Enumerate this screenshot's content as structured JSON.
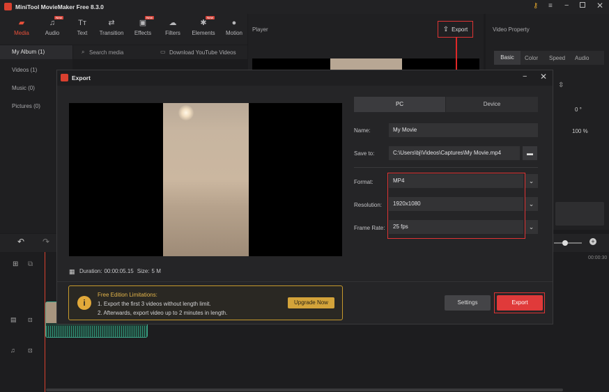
{
  "app": {
    "title": "MiniTool MovieMaker Free 8.3.0"
  },
  "toolbar": {
    "tabs": [
      {
        "label": "Media",
        "icon": "folder-icon"
      },
      {
        "label": "Audio",
        "icon": "music-icon"
      },
      {
        "label": "Text",
        "icon": "text-icon"
      },
      {
        "label": "Transition",
        "icon": "transition-icon"
      },
      {
        "label": "Effects",
        "icon": "effects-icon"
      },
      {
        "label": "Filters",
        "icon": "filters-icon"
      },
      {
        "label": "Elements",
        "icon": "elements-icon"
      },
      {
        "label": "Motion",
        "icon": "motion-icon"
      }
    ],
    "new_badge": "New"
  },
  "sidebar": {
    "items": [
      {
        "label": "My Album (1)"
      },
      {
        "label": "Videos (1)"
      },
      {
        "label": "Music (0)"
      },
      {
        "label": "Pictures (0)"
      }
    ]
  },
  "media": {
    "search_placeholder": "Search media",
    "download_label": "Download YouTube Videos"
  },
  "player": {
    "title": "Player",
    "export_label": "Export"
  },
  "video_property": {
    "title": "Video Property",
    "tabs": [
      "Basic",
      "Color",
      "Speed",
      "Audio"
    ],
    "rotation": "0 °",
    "scale": "100 %"
  },
  "timeline": {
    "ruler_end": "00:00:30"
  },
  "export_dialog": {
    "title": "Export",
    "target_tabs": [
      "PC",
      "Device"
    ],
    "fields": {
      "name_label": "Name:",
      "name_value": "My Movie",
      "save_label": "Save to:",
      "save_value": "C:\\Users\\bj\\Videos\\Captures\\My Movie.mp4",
      "format_label": "Format:",
      "format_value": "MP4",
      "resolution_label": "Resolution:",
      "resolution_value": "1920x1080",
      "framerate_label": "Frame Rate:",
      "framerate_value": "25 fps"
    },
    "duration_label": "Duration:",
    "duration_value": "00:00:05.15",
    "size_label": "Size:",
    "size_value": "5 M",
    "limits": {
      "title": "Free Edition Limitations:",
      "line1": "1. Export the first 3 videos without length limit.",
      "line2": "2. Afterwards, export video up to 2 minutes in length.",
      "upgrade_label": "Upgrade Now"
    },
    "settings_label": "Settings",
    "export_label": "Export"
  },
  "colors": {
    "accent": "#e8503a",
    "export_button": "#e03a3a",
    "highlight_box": "#e03434",
    "limits_border": "#c79a2c",
    "upgrade_button": "#d4a43a"
  }
}
